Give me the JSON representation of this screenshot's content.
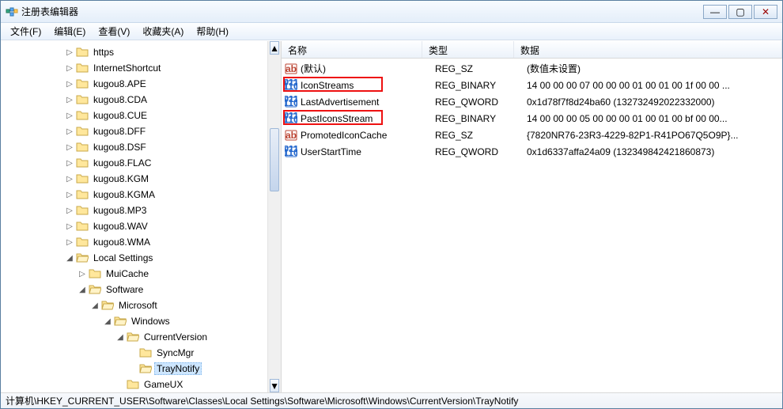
{
  "title": "注册表编辑器",
  "menu": {
    "file": "文件(F)",
    "edit": "编辑(E)",
    "view": "查看(V)",
    "fav": "收藏夹(A)",
    "help": "帮助(H)"
  },
  "tree": [
    {
      "indent": 5,
      "toggle": "▷",
      "label": "https"
    },
    {
      "indent": 5,
      "toggle": "▷",
      "label": "InternetShortcut"
    },
    {
      "indent": 5,
      "toggle": "▷",
      "label": "kugou8.APE"
    },
    {
      "indent": 5,
      "toggle": "▷",
      "label": "kugou8.CDA"
    },
    {
      "indent": 5,
      "toggle": "▷",
      "label": "kugou8.CUE"
    },
    {
      "indent": 5,
      "toggle": "▷",
      "label": "kugou8.DFF"
    },
    {
      "indent": 5,
      "toggle": "▷",
      "label": "kugou8.DSF"
    },
    {
      "indent": 5,
      "toggle": "▷",
      "label": "kugou8.FLAC"
    },
    {
      "indent": 5,
      "toggle": "▷",
      "label": "kugou8.KGM"
    },
    {
      "indent": 5,
      "toggle": "▷",
      "label": "kugou8.KGMA"
    },
    {
      "indent": 5,
      "toggle": "▷",
      "label": "kugou8.MP3"
    },
    {
      "indent": 5,
      "toggle": "▷",
      "label": "kugou8.WAV"
    },
    {
      "indent": 5,
      "toggle": "▷",
      "label": "kugou8.WMA"
    },
    {
      "indent": 5,
      "toggle": "◢",
      "label": "Local Settings"
    },
    {
      "indent": 6,
      "toggle": "▷",
      "label": "MuiCache"
    },
    {
      "indent": 6,
      "toggle": "◢",
      "label": "Software"
    },
    {
      "indent": 7,
      "toggle": "◢",
      "label": "Microsoft"
    },
    {
      "indent": 8,
      "toggle": "◢",
      "label": "Windows"
    },
    {
      "indent": 9,
      "toggle": "◢",
      "label": "CurrentVersion"
    },
    {
      "indent": 10,
      "toggle": "",
      "label": "SyncMgr"
    },
    {
      "indent": 10,
      "toggle": "",
      "label": "TrayNotify",
      "selected": true
    },
    {
      "indent": 9,
      "toggle": "",
      "label": "GameUX"
    }
  ],
  "cols": {
    "name": "名称",
    "type": "类型",
    "data": "数据"
  },
  "values": [
    {
      "icon": "str",
      "name": "(默认)",
      "type": "REG_SZ",
      "data": "(数值未设置)"
    },
    {
      "icon": "bin",
      "name": "IconStreams",
      "type": "REG_BINARY",
      "data": "14 00 00 00 07 00 00 00 01 00 01 00 1f 00 00 ...",
      "hl": true
    },
    {
      "icon": "bin",
      "name": "LastAdvertisement",
      "type": "REG_QWORD",
      "data": "0x1d78f7f8d24ba60 (132732492022332000)"
    },
    {
      "icon": "bin",
      "name": "PastIconsStream",
      "type": "REG_BINARY",
      "data": "14 00 00 00 05 00 00 00 01 00 01 00 bf 00 00...",
      "hl": true
    },
    {
      "icon": "str",
      "name": "PromotedIconCache",
      "type": "REG_SZ",
      "data": "{7820NR76-23R3-4229-82P1-R41PO67Q5O9P}..."
    },
    {
      "icon": "bin",
      "name": "UserStartTime",
      "type": "REG_QWORD",
      "data": "0x1d6337affa24a09 (132349842421860873)"
    }
  ],
  "status": "计算机\\HKEY_CURRENT_USER\\Software\\Classes\\Local Settings\\Software\\Microsoft\\Windows\\CurrentVersion\\TrayNotify"
}
